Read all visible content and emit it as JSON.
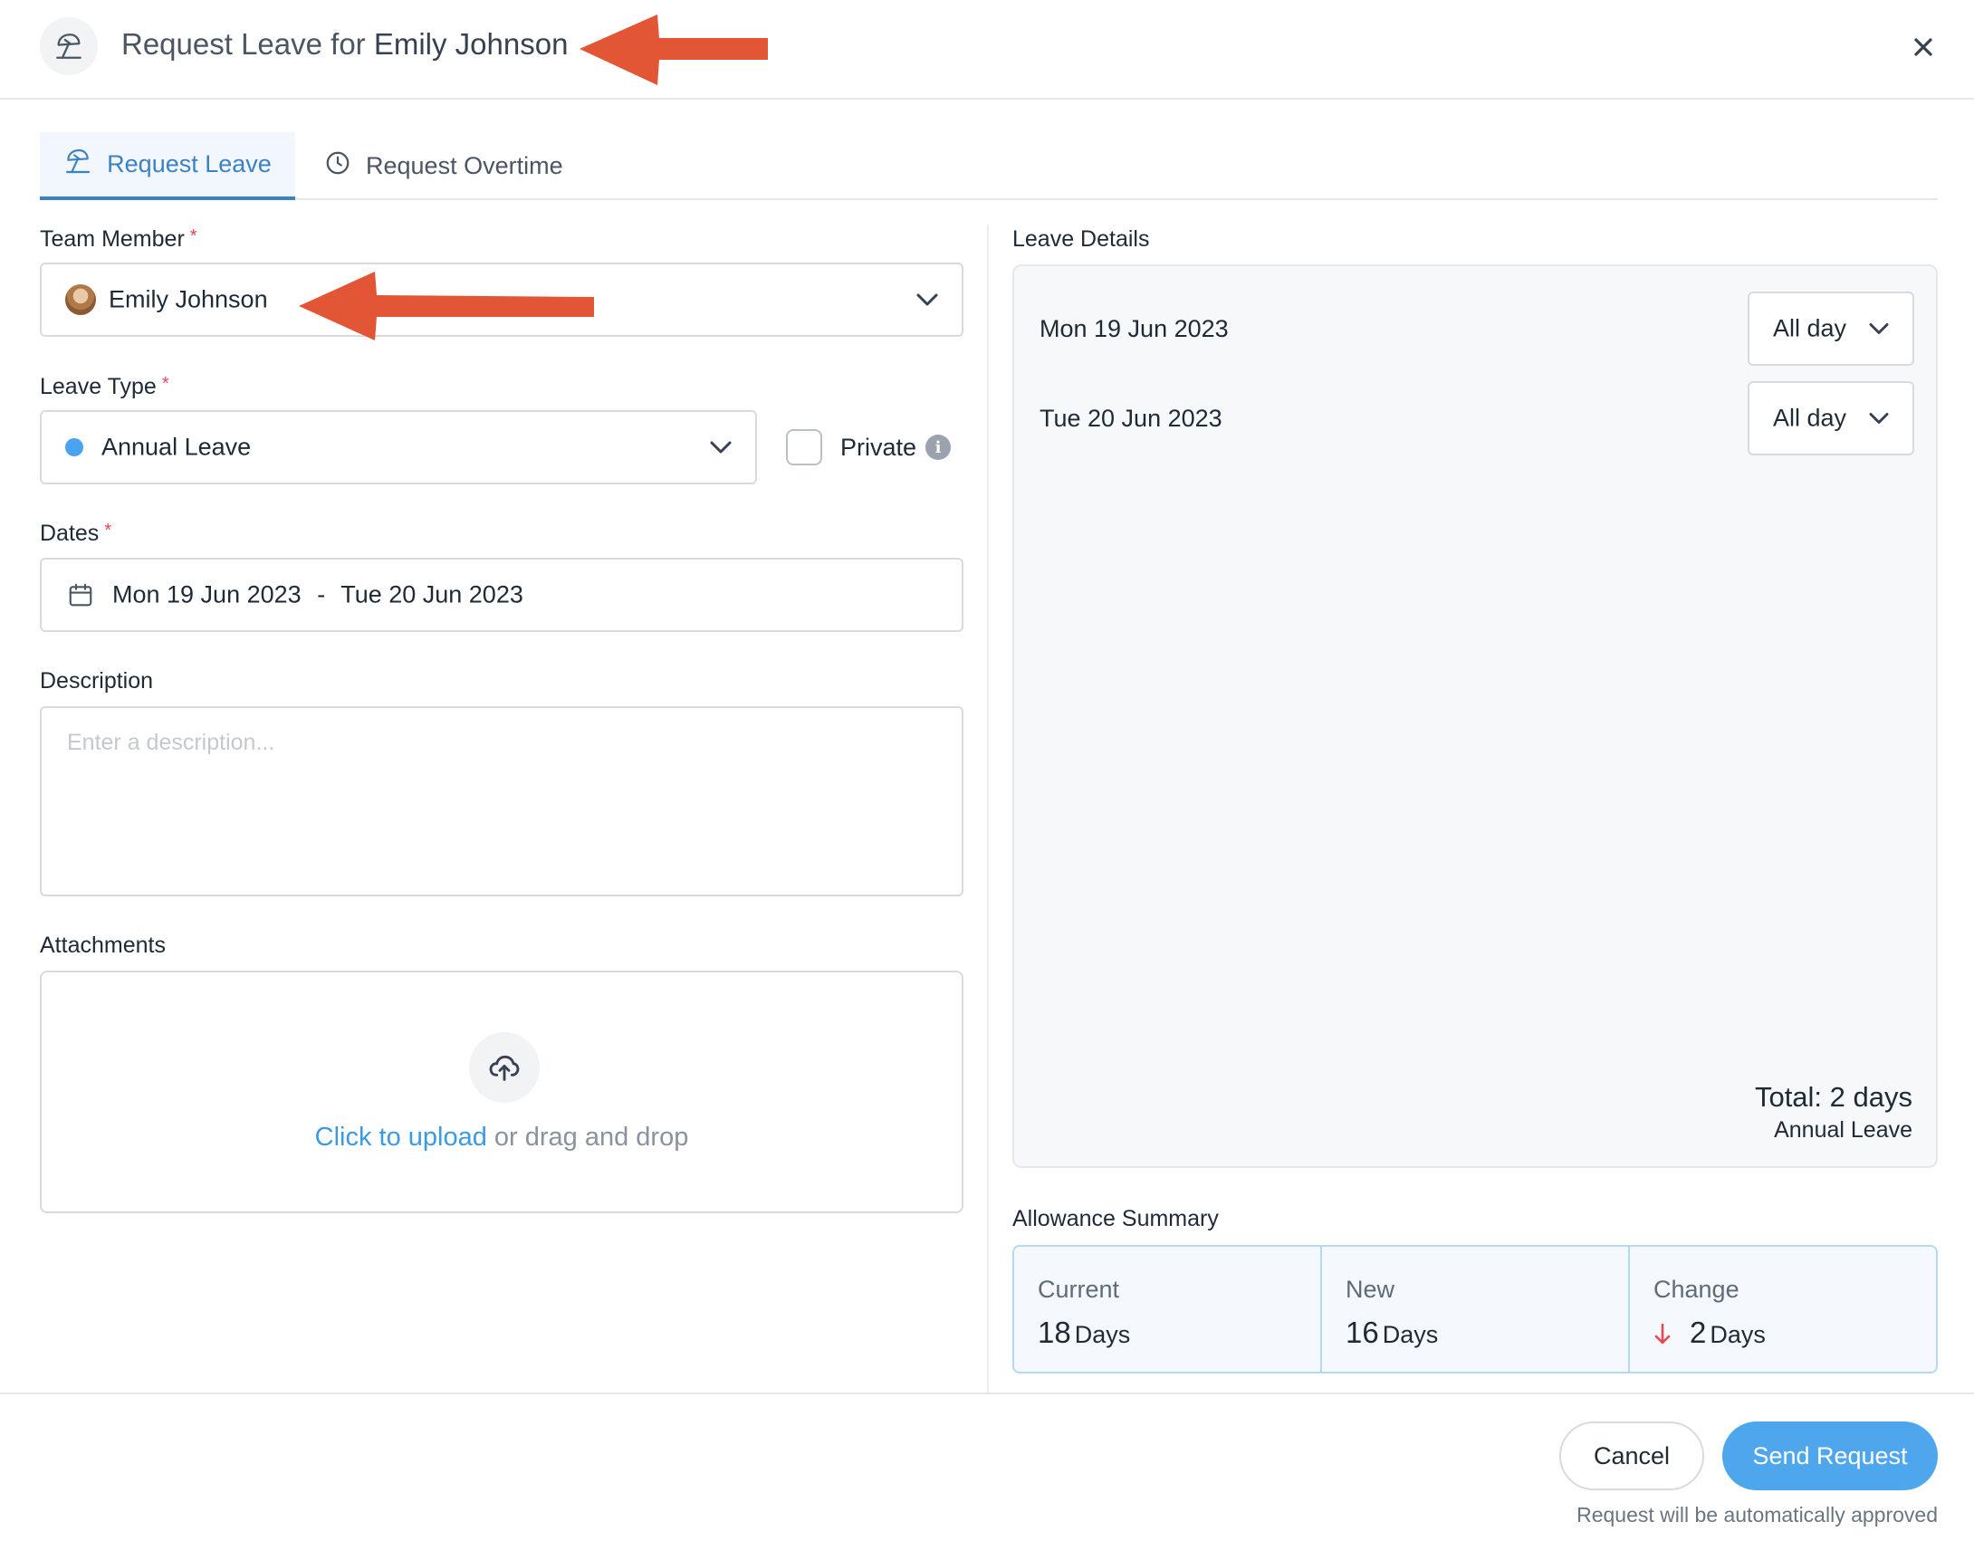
{
  "header": {
    "title_prefix": "Request Leave for",
    "title_name": "Emily Johnson",
    "icon": "beach-umbrella-icon",
    "close_icon": "close-icon"
  },
  "tabs": [
    {
      "label": "Request Leave",
      "icon": "beach-umbrella-icon",
      "active": true
    },
    {
      "label": "Request Overtime",
      "icon": "clock-icon",
      "active": false
    }
  ],
  "form": {
    "team_member": {
      "label": "Team Member",
      "required_mark": "*",
      "value": "Emily Johnson"
    },
    "leave_type": {
      "label": "Leave Type",
      "required_mark": "*",
      "value": "Annual Leave",
      "dot_color": "#4aa3f0"
    },
    "private": {
      "label": "Private",
      "checked": false
    },
    "dates": {
      "label": "Dates",
      "required_mark": "*",
      "start": "Mon 19 Jun 2023",
      "separator": "-",
      "end": "Tue 20 Jun 2023"
    },
    "description": {
      "label": "Description",
      "placeholder": "Enter a description..."
    },
    "attachments": {
      "label": "Attachments",
      "upload_link": "Click to upload",
      "upload_rest": "or drag and drop"
    }
  },
  "leave_details": {
    "title": "Leave Details",
    "rows": [
      {
        "date": "Mon 19 Jun 2023",
        "period": "All day"
      },
      {
        "date": "Tue 20 Jun 2023",
        "period": "All day"
      }
    ],
    "total": "Total: 2 days",
    "total_type": "Annual Leave"
  },
  "allowance": {
    "title": "Allowance Summary",
    "current": {
      "label": "Current",
      "value": "18",
      "unit": "Days"
    },
    "new": {
      "label": "New",
      "value": "16",
      "unit": "Days"
    },
    "change": {
      "label": "Change",
      "value": "2",
      "unit": "Days",
      "arrow_color": "#e5484d"
    }
  },
  "footer": {
    "cancel_label": "Cancel",
    "send_label": "Send Request",
    "note": "Request will be automatically approved"
  },
  "colors": {
    "accent": "#3b82c4",
    "primary_button": "#4ea6ec",
    "annotation_arrow": "#e25535"
  }
}
